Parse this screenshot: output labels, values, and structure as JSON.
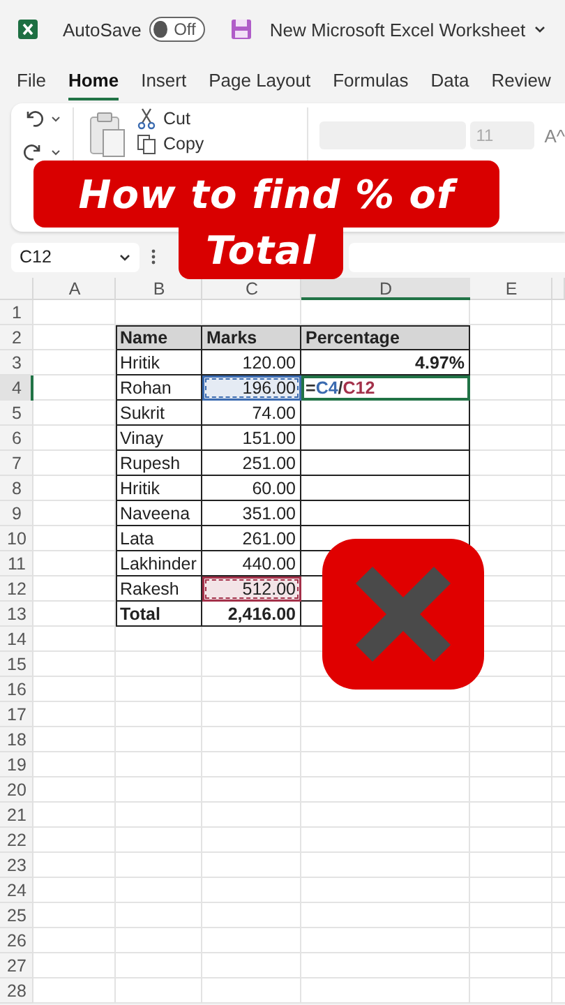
{
  "title_bar": {
    "autosave_label": "AutoSave",
    "autosave": {
      "on": false,
      "label": "Off"
    },
    "document_title": "New Microsoft Excel Worksheet"
  },
  "ribbon_tabs": [
    {
      "label": "File",
      "selected": false
    },
    {
      "label": "Home",
      "selected": true
    },
    {
      "label": "Insert",
      "selected": false
    },
    {
      "label": "Page Layout",
      "selected": false
    },
    {
      "label": "Formulas",
      "selected": false
    },
    {
      "label": "Data",
      "selected": false
    },
    {
      "label": "Review",
      "selected": false
    }
  ],
  "ribbon": {
    "cut_label": "Cut",
    "copy_label": "Copy",
    "font_size": "11",
    "grow_font_label": "A^"
  },
  "name_box": "C12",
  "columns": [
    {
      "label": "A",
      "selected": false
    },
    {
      "label": "B",
      "selected": false
    },
    {
      "label": "C",
      "selected": false
    },
    {
      "label": "D",
      "selected": true
    },
    {
      "label": "E",
      "selected": false
    }
  ],
  "row_numbers": [
    {
      "label": "1",
      "selected": false
    },
    {
      "label": "2",
      "selected": false
    },
    {
      "label": "3",
      "selected": false
    },
    {
      "label": "4",
      "selected": true
    },
    {
      "label": "5",
      "selected": false
    },
    {
      "label": "6",
      "selected": false
    },
    {
      "label": "7",
      "selected": false
    },
    {
      "label": "8",
      "selected": false
    },
    {
      "label": "9",
      "selected": false
    },
    {
      "label": "10",
      "selected": false
    },
    {
      "label": "11",
      "selected": false
    },
    {
      "label": "12",
      "selected": false
    },
    {
      "label": "13",
      "selected": false
    },
    {
      "label": "14",
      "selected": false
    },
    {
      "label": "15",
      "selected": false
    },
    {
      "label": "16",
      "selected": false
    },
    {
      "label": "17",
      "selected": false
    },
    {
      "label": "18",
      "selected": false
    },
    {
      "label": "19",
      "selected": false
    },
    {
      "label": "20",
      "selected": false
    },
    {
      "label": "21",
      "selected": false
    },
    {
      "label": "22",
      "selected": false
    },
    {
      "label": "23",
      "selected": false
    },
    {
      "label": "24",
      "selected": false
    },
    {
      "label": "25",
      "selected": false
    },
    {
      "label": "26",
      "selected": false
    },
    {
      "label": "27",
      "selected": false
    },
    {
      "label": "28",
      "selected": false
    }
  ],
  "table": {
    "header": [
      "Name",
      "Marks",
      "Percentage"
    ],
    "rows": [
      {
        "kind": "data",
        "name": "Hritik",
        "marks": "120.00",
        "percentage": "4.97%"
      },
      {
        "kind": "data",
        "name": "Rohan",
        "marks": "196.00",
        "ref_highlight": {
          "color": "#3b6bb0"
        },
        "formula": [
          {
            "text": "=",
            "color": "#333333"
          },
          {
            "text": "C4",
            "color": "#3b6bb0"
          },
          {
            "text": "/",
            "color": "#333333"
          },
          {
            "text": "C12",
            "color": "#a3314a"
          }
        ]
      },
      {
        "kind": "data",
        "name": "Sukrit",
        "marks": "74.00"
      },
      {
        "kind": "data",
        "name": "Vinay",
        "marks": "151.00"
      },
      {
        "kind": "data",
        "name": "Rupesh",
        "marks": "251.00"
      },
      {
        "kind": "data",
        "name": "Hritik",
        "marks": "60.00"
      },
      {
        "kind": "data",
        "name": "Naveena",
        "marks": "351.00"
      },
      {
        "kind": "data",
        "name": "Lata",
        "marks": "261.00"
      },
      {
        "kind": "data",
        "name": "Lakhinder",
        "marks": "440.00"
      },
      {
        "kind": "data",
        "name": "Rakesh",
        "marks": "512.00",
        "ref_highlight": {
          "color": "#a3314a"
        }
      },
      {
        "kind": "total",
        "name": "Total",
        "marks": "2,416.00"
      }
    ]
  },
  "overlay_title": [
    "How to find % of",
    "Total"
  ]
}
